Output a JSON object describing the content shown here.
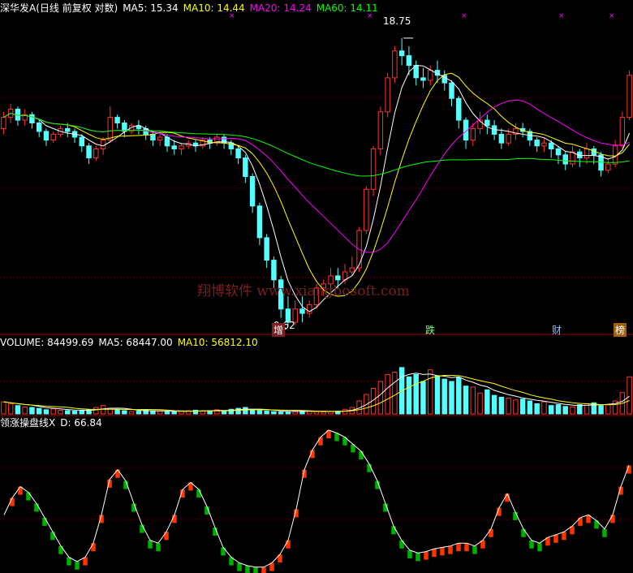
{
  "colors": {
    "background": "#000000",
    "grid": "#800000",
    "up": "#ff3333",
    "down": "#54ffff",
    "ma5": "#ffffff",
    "ma10": "#ffff00",
    "ma20": "#ff00ff",
    "ma60": "#00ff00",
    "osc_line": "#ffffff",
    "osc_up": "#ff3300",
    "osc_down": "#00b000"
  },
  "price_header": {
    "name": "深华发A(日线 前复权 对数)",
    "ma5": "MA5: 15.34",
    "ma10": "MA10: 14.44",
    "ma20": "MA20: 14.24",
    "ma60": "MA60: 14.11"
  },
  "volume_header": {
    "volume": "VOLUME: 84499.69",
    "ma5": "MA5: 68447.00",
    "ma10": "MA10: 56812.10"
  },
  "osc_header": {
    "name": "领涨操盘线X",
    "d": "D: 66.84"
  },
  "watermark": "翔博软件 www.xiangbosoft.com",
  "annotations": {
    "high": "18.75",
    "low": "9.62",
    "markers": [
      "增",
      "跌",
      "财",
      "榜"
    ]
  },
  "chart_data": {
    "type": "candlestick",
    "ylim": [
      9.5,
      19.8
    ],
    "volume_ylim": [
      0,
      140000
    ],
    "osc_ylim": [
      0,
      100
    ],
    "candles": [
      [
        15.2,
        15.6,
        15.8,
        15.0
      ],
      [
        15.6,
        15.9,
        16.1,
        15.4
      ],
      [
        15.9,
        15.5,
        16.0,
        15.3
      ],
      [
        15.5,
        15.7,
        15.9,
        15.3
      ],
      [
        15.7,
        15.4,
        15.8,
        15.2
      ],
      [
        15.4,
        15.1,
        15.5,
        14.9
      ],
      [
        15.1,
        14.8,
        15.2,
        14.6
      ],
      [
        14.8,
        15.0,
        15.1,
        14.7
      ],
      [
        15.0,
        15.2,
        15.3,
        14.9
      ],
      [
        15.2,
        15.1,
        15.4,
        14.9
      ],
      [
        15.1,
        14.9,
        15.2,
        14.7
      ],
      [
        14.9,
        14.6,
        15.0,
        14.4
      ],
      [
        14.6,
        14.2,
        14.7,
        14.0
      ],
      [
        14.2,
        14.5,
        14.6,
        14.1
      ],
      [
        14.5,
        14.8,
        14.9,
        14.3
      ],
      [
        14.8,
        15.6,
        16.0,
        14.7
      ],
      [
        15.6,
        15.4,
        15.7,
        15.2
      ],
      [
        15.4,
        15.1,
        15.5,
        14.9
      ],
      [
        15.1,
        15.3,
        15.4,
        15.0
      ],
      [
        15.3,
        15.2,
        15.5,
        15.0
      ],
      [
        15.2,
        15.0,
        15.3,
        14.8
      ],
      [
        15.0,
        14.8,
        15.1,
        14.6
      ],
      [
        14.8,
        14.9,
        15.0,
        14.6
      ],
      [
        14.9,
        14.6,
        15.0,
        14.4
      ],
      [
        14.6,
        14.5,
        14.8,
        14.3
      ],
      [
        14.5,
        14.6,
        14.7,
        14.3
      ],
      [
        14.6,
        14.7,
        14.8,
        14.5
      ],
      [
        14.7,
        14.6,
        14.8,
        14.4
      ],
      [
        14.6,
        14.8,
        14.9,
        14.5
      ],
      [
        14.8,
        14.7,
        14.9,
        14.5
      ],
      [
        14.7,
        14.9,
        15.0,
        14.6
      ],
      [
        14.9,
        14.7,
        15.0,
        14.5
      ],
      [
        14.7,
        14.5,
        14.8,
        14.3
      ],
      [
        14.5,
        14.2,
        14.6,
        14.0
      ],
      [
        14.2,
        13.6,
        14.3,
        13.4
      ],
      [
        13.6,
        12.7,
        13.7,
        12.5
      ],
      [
        12.7,
        11.8,
        12.8,
        11.6
      ],
      [
        11.8,
        11.2,
        11.9,
        11.0
      ],
      [
        11.2,
        10.7,
        11.3,
        10.5
      ],
      [
        10.7,
        10.0,
        10.8,
        9.8
      ],
      [
        10.0,
        9.7,
        10.3,
        9.62
      ],
      [
        9.7,
        10.0,
        10.2,
        9.62
      ],
      [
        10.0,
        9.9,
        10.3,
        9.7
      ],
      [
        9.9,
        10.1,
        10.2,
        9.8
      ],
      [
        10.1,
        10.5,
        10.6,
        10.0
      ],
      [
        10.5,
        10.6,
        10.7,
        10.3
      ],
      [
        10.6,
        10.8,
        11.0,
        10.5
      ],
      [
        10.8,
        10.7,
        11.0,
        10.5
      ],
      [
        10.7,
        10.9,
        11.1,
        10.6
      ],
      [
        10.9,
        11.0,
        11.3,
        10.8
      ],
      [
        11.0,
        12.0,
        12.1,
        10.9
      ],
      [
        12.0,
        13.2,
        13.3,
        11.9
      ],
      [
        13.2,
        14.5,
        14.6,
        13.0
      ],
      [
        14.5,
        15.8,
        16.0,
        14.3
      ],
      [
        15.8,
        17.1,
        17.3,
        15.6
      ],
      [
        17.1,
        18.2,
        18.4,
        16.9
      ],
      [
        18.2,
        18.0,
        18.75,
        17.6
      ],
      [
        18.0,
        17.6,
        18.4,
        17.2
      ],
      [
        17.6,
        17.1,
        17.8,
        16.8
      ],
      [
        17.1,
        17.0,
        17.5,
        16.7
      ],
      [
        17.0,
        17.4,
        17.6,
        16.8
      ],
      [
        17.4,
        17.2,
        17.8,
        16.9
      ],
      [
        17.2,
        16.9,
        17.4,
        16.6
      ],
      [
        16.9,
        16.3,
        17.0,
        16.0
      ],
      [
        16.3,
        15.5,
        16.4,
        15.2
      ],
      [
        15.5,
        14.8,
        15.6,
        14.5
      ],
      [
        14.8,
        15.2,
        15.4,
        14.6
      ],
      [
        15.2,
        15.5,
        15.8,
        15.0
      ],
      [
        15.5,
        15.3,
        15.7,
        15.0
      ],
      [
        15.3,
        15.0,
        15.5,
        14.8
      ],
      [
        15.0,
        14.7,
        15.2,
        14.5
      ],
      [
        14.7,
        15.0,
        15.2,
        14.6
      ],
      [
        15.0,
        15.2,
        15.4,
        14.8
      ],
      [
        15.2,
        15.1,
        15.4,
        14.9
      ],
      [
        15.1,
        14.8,
        15.2,
        14.6
      ],
      [
        14.8,
        14.6,
        14.9,
        14.4
      ],
      [
        14.6,
        14.7,
        14.9,
        14.4
      ],
      [
        14.7,
        14.5,
        14.8,
        14.2
      ],
      [
        14.5,
        14.3,
        14.6,
        14.0
      ],
      [
        14.3,
        14.0,
        14.4,
        13.8
      ],
      [
        14.0,
        14.4,
        14.6,
        13.9
      ],
      [
        14.4,
        14.2,
        14.5,
        13.9
      ],
      [
        14.2,
        14.5,
        14.7,
        14.0
      ],
      [
        14.5,
        14.3,
        14.6,
        14.0
      ],
      [
        14.3,
        13.8,
        14.4,
        13.6
      ],
      [
        13.8,
        14.0,
        14.2,
        13.7
      ],
      [
        14.0,
        14.6,
        14.8,
        13.9
      ],
      [
        14.6,
        15.6,
        15.8,
        14.5
      ],
      [
        15.6,
        17.2,
        17.4,
        15.5
      ]
    ],
    "volume": [
      26000,
      22000,
      18000,
      15000,
      14000,
      12000,
      9000,
      11000,
      8000,
      7000,
      6000,
      8000,
      9000,
      14000,
      18000,
      12000,
      9000,
      7000,
      5000,
      6000,
      8000,
      7000,
      6000,
      5000,
      5000,
      6000,
      7000,
      8000,
      6000,
      7000,
      9000,
      7000,
      10000,
      12000,
      14000,
      9000,
      7000,
      6000,
      5000,
      4000,
      5000,
      6000,
      7000,
      6000,
      5000,
      4500,
      5000,
      6000,
      10000,
      14000,
      28000,
      42000,
      55000,
      70000,
      85000,
      90000,
      100000,
      80000,
      85000,
      70000,
      95000,
      82000,
      75000,
      70000,
      78000,
      60000,
      58000,
      45000,
      52000,
      40000,
      36000,
      34000,
      30000,
      32000,
      28000,
      22000,
      26000,
      18000,
      20000,
      16000,
      15000,
      20000,
      22000,
      24000,
      18000,
      20000,
      28000,
      46000,
      80000
    ],
    "oscillator": [
      40,
      52,
      60,
      56,
      48,
      38,
      28,
      18,
      10,
      7,
      10,
      20,
      40,
      65,
      72,
      64,
      48,
      33,
      22,
      20,
      28,
      40,
      58,
      63,
      58,
      46,
      31,
      17,
      10,
      6,
      4,
      3,
      3,
      6,
      12,
      22,
      44,
      72,
      86,
      95,
      100,
      98,
      95,
      90,
      85,
      76,
      64,
      48,
      32,
      22,
      15,
      13,
      14,
      16,
      17,
      18,
      20,
      20,
      18,
      22,
      30,
      45,
      55,
      42,
      30,
      22,
      20,
      24,
      26,
      28,
      32,
      38,
      40,
      36,
      30,
      40,
      60,
      75
    ],
    "series": [
      {
        "name": "MA5",
        "value": "15.34"
      },
      {
        "name": "MA10",
        "value": "14.44"
      },
      {
        "name": "MA20",
        "value": "14.24"
      },
      {
        "name": "MA60",
        "value": "14.11"
      }
    ]
  }
}
